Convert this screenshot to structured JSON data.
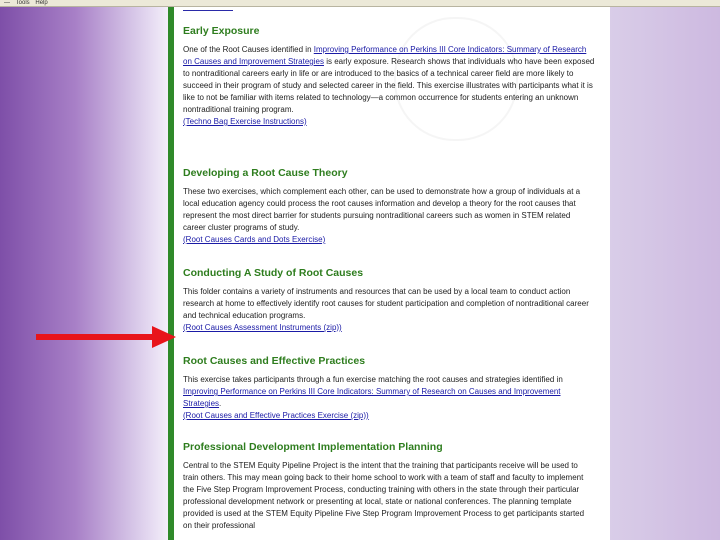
{
  "toolbar": {
    "items": [
      "—",
      "Tools",
      "Help"
    ]
  },
  "sections": [
    {
      "title": "Early Exposure",
      "pre": "One of the Root Causes identified in ",
      "link": "Improving Performance on Perkins III Core Indicators: Summary of Research on Causes and Improvement Strategies",
      "post": " is early exposure. Research shows that individuals who have been exposed to nontraditional careers early in life or are introduced to the basics of a technical career field are more likely to succeed in their program of study and selected career in the field. This exercise illustrates with participants what it is like to not be familiar with items related to technology—a common occurrence for students entering an unknown nontraditional training program.",
      "download": "(Techno Bag Exercise Instructions)"
    },
    {
      "title": "Developing a Root Cause Theory",
      "pre": "These two exercises, which complement each other, can be used to demonstrate how a group of individuals at a local education agency could process the root causes information and develop a theory for the root causes that represent the most direct barrier for students pursuing nontraditional careers such as women in STEM related career cluster programs of study.",
      "link": "",
      "post": "",
      "download": "(Root Causes Cards and Dots Exercise)"
    },
    {
      "title": "Conducting A Study of Root Causes",
      "pre": "This folder contains a variety of instruments and resources that can be used by a local team to conduct action research at home to effectively identify root causes for student participation and completion of nontraditional career and technical education programs.",
      "link": "",
      "post": "",
      "download": "(Root Causes Assessment Instruments (zip))"
    },
    {
      "title": "Root Causes and Effective Practices",
      "pre": "This exercise takes participants through a fun exercise matching the root causes and strategies identified in ",
      "link": "Improving Performance on Perkins III Core Indicators: Summary of Research on Causes and Improvement Strategies",
      "post": ".",
      "download": "(Root Causes and Effective Practices Exercise (zip))"
    },
    {
      "title": "Professional Development Implementation Planning",
      "pre": "Central to the STEM Equity Pipeline Project is the intent that the training that participants receive will be used to train others. This may mean going back to their home school to work with a team of staff and faculty to implement the Five Step Program Improvement Process, conducting training with others in the state through their particular professional development network or presenting at local, state or national conferences. The planning template provided is used at the STEM Equity Pipeline Five Step Program Improvement Process to get participants started on their professional",
      "link": "",
      "post": "",
      "download": ""
    }
  ]
}
